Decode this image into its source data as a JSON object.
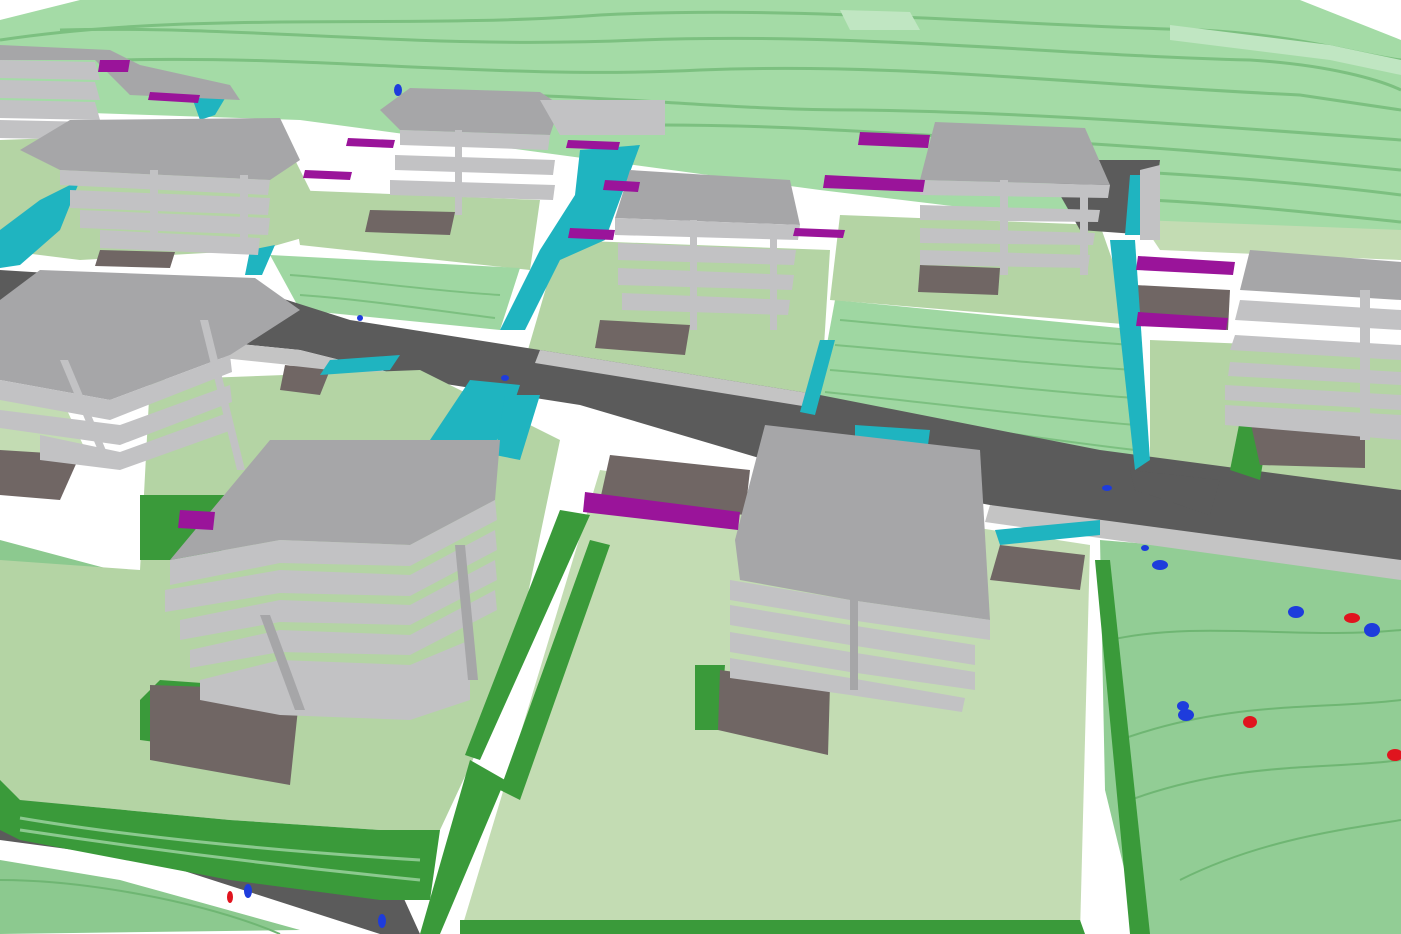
{
  "scene": {
    "kind": "3d-site-model-render",
    "colors": {
      "terrain_light": "#9fd7a2",
      "terrain_mid": "#8cc98f",
      "terrace_edge": "#6fb673",
      "lawn": "#b4d4a4",
      "lawn_pale": "#c3dcb3",
      "grass_bright": "#3a9a3a",
      "road": "#5b5b5b",
      "pavement": "#c4c4c4",
      "building_top": "#a6a6a8",
      "building_side": "#c2c2c4",
      "garage_floor": "#706664",
      "bridge": "#9a149a",
      "water_stair": "#1fb4c0",
      "vehicle_blue": "#1e3cdc",
      "vehicle_red": "#e0141e"
    },
    "building_count": 8,
    "bridge_count": 14
  }
}
